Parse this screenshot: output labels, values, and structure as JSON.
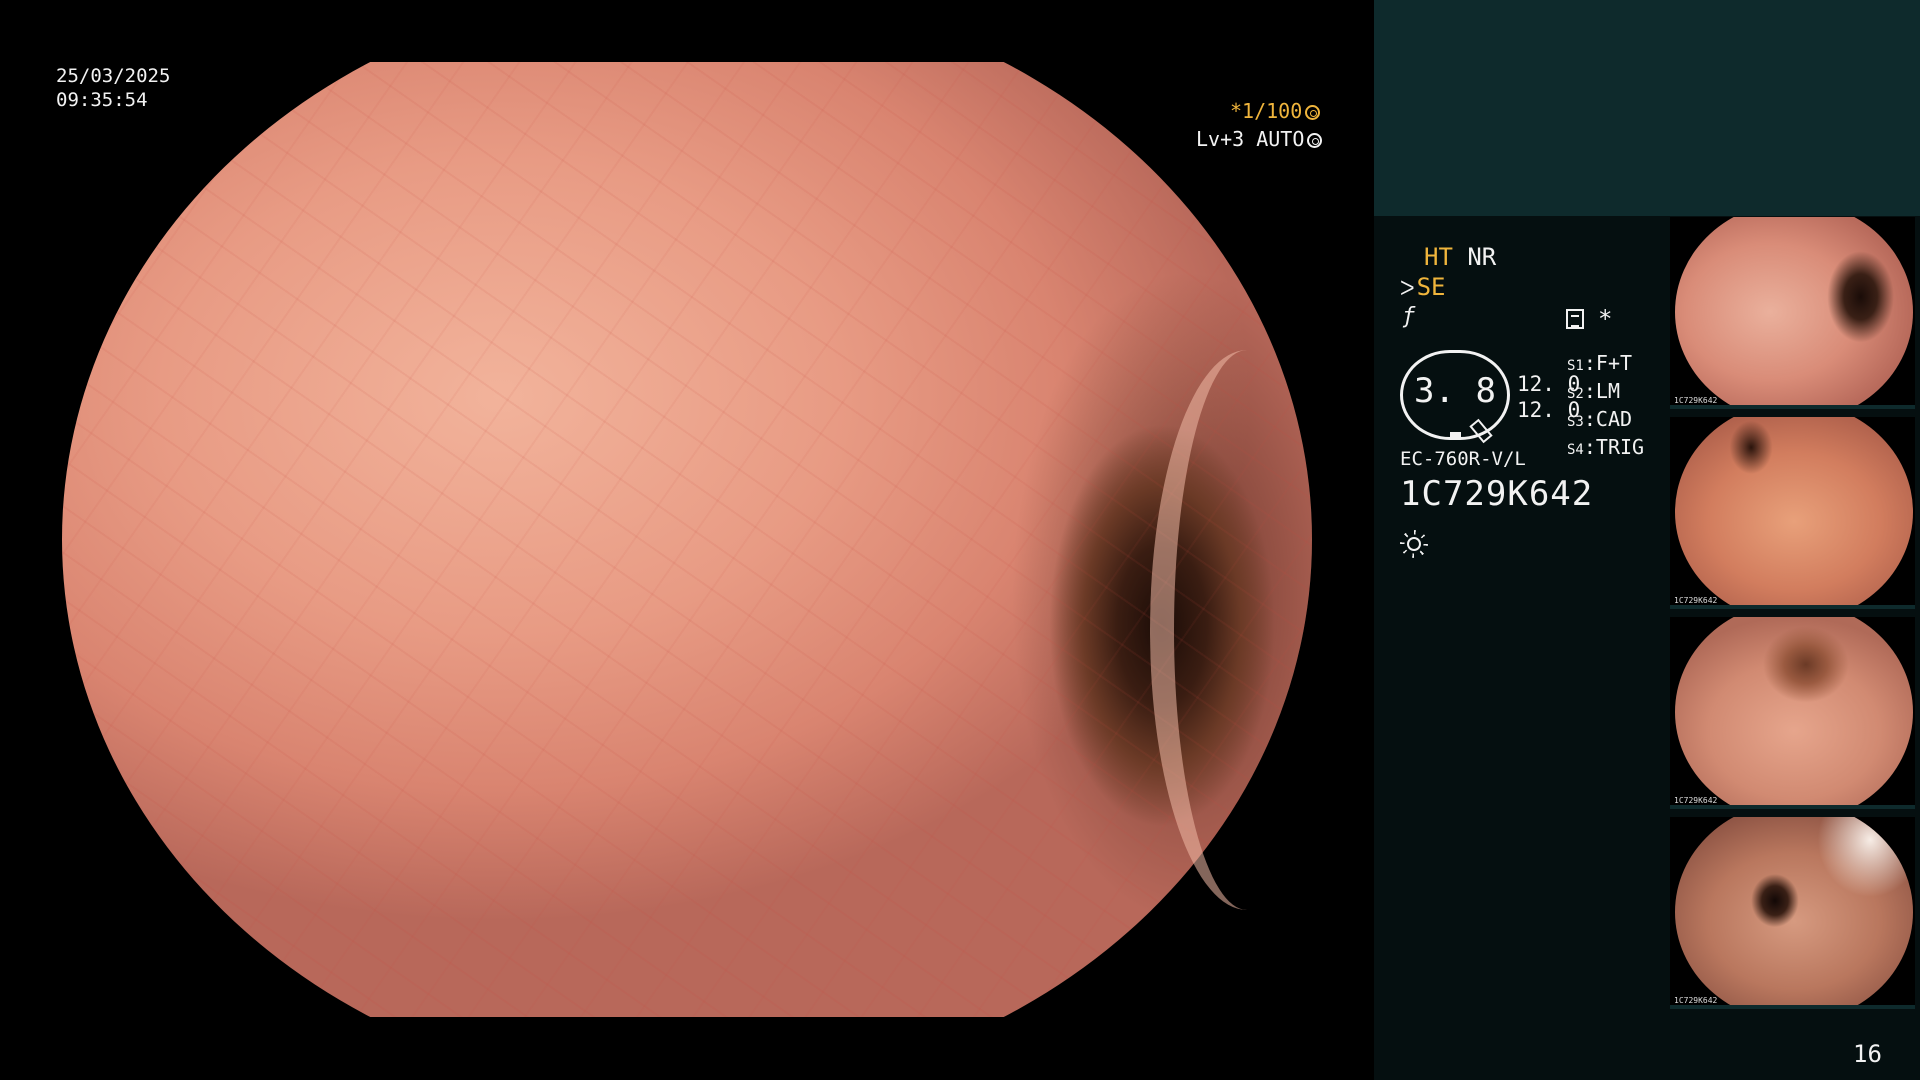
{
  "overlay": {
    "date": "25/03/2025",
    "time": "09:35:54",
    "shutter": "*1/100",
    "level_mode": "Lv+3 AUTO"
  },
  "side_panel": {
    "mode_ht": "HT",
    "mode_nr": "NR",
    "se_label": "SE",
    "star": "*",
    "zoom_value": "3. 8",
    "level_values": [
      "12. 0",
      "12. 0"
    ],
    "slots": [
      {
        "key": "S1",
        "value": "F+T"
      },
      {
        "key": "S2",
        "value": "LM"
      },
      {
        "key": "S3",
        "value": "CAD"
      },
      {
        "key": "S4",
        "value": "TRIG"
      }
    ],
    "scope_model": "EC-760R-V/L",
    "serial": "1C729K642"
  },
  "thumbnails": [
    {
      "caption": "1C729K642"
    },
    {
      "caption": "1C729K642"
    },
    {
      "caption": "1C729K642"
    },
    {
      "caption": "1C729K642"
    }
  ],
  "page_number": "16",
  "colors": {
    "accent_amber": "#f0b53c",
    "panel_dark": "#050f10",
    "panel_teal": "#0e2a2c",
    "text": "#f2f2f2"
  },
  "icons": [
    "aperture-icon",
    "auto-iris-icon",
    "filter-icon",
    "memo-icon",
    "light-icon"
  ]
}
